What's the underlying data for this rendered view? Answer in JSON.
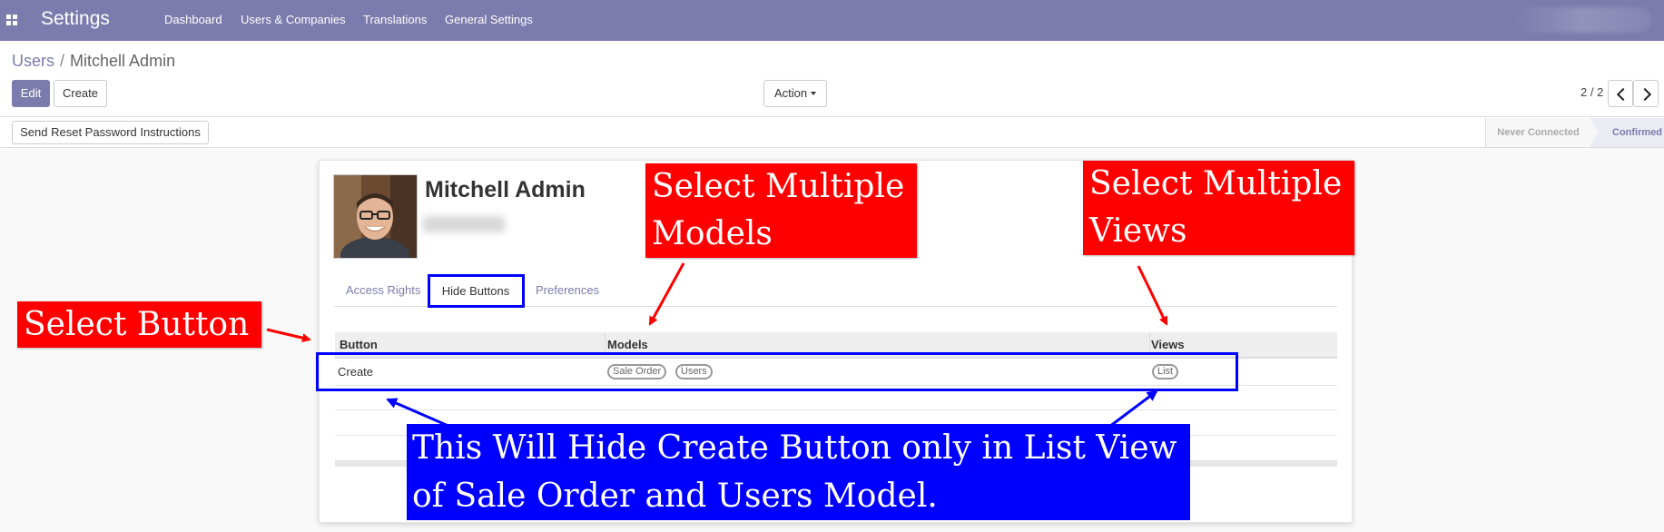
{
  "navbar": {
    "brand": "Settings",
    "menu": [
      "Dashboard",
      "Users & Companies",
      "Translations",
      "General Settings"
    ]
  },
  "breadcrumb": {
    "parent": "Users",
    "separator": "/",
    "current": "Mitchell Admin"
  },
  "toolbar": {
    "edit_label": "Edit",
    "create_label": "Create",
    "action_label": "Action",
    "pager": "2 / 2"
  },
  "header": {
    "reset_button": "Send Reset Password Instructions",
    "stages": [
      "Never Connected",
      "Confirmed"
    ]
  },
  "user": {
    "name": "Mitchell Admin"
  },
  "tabs": [
    "Access Rights",
    "Hide Buttons",
    "Preferences"
  ],
  "table": {
    "columns": [
      "Button",
      "Models",
      "Views"
    ],
    "rows": [
      {
        "button": "Create",
        "models": [
          "Sale Order",
          "Users"
        ],
        "views": [
          "List"
        ]
      }
    ]
  },
  "annotations": {
    "select_models": [
      "Select Multiple",
      "Models"
    ],
    "select_views": [
      "Select Multiple",
      "Views"
    ],
    "select_button": "Select Button",
    "explanation": [
      "This Will Hide Create Button only in List View",
      "of Sale Order and Users Model."
    ]
  },
  "colors": {
    "navbar": "#7c7bad",
    "annotation_red": "#ff0000",
    "annotation_blue": "#0000ff"
  }
}
